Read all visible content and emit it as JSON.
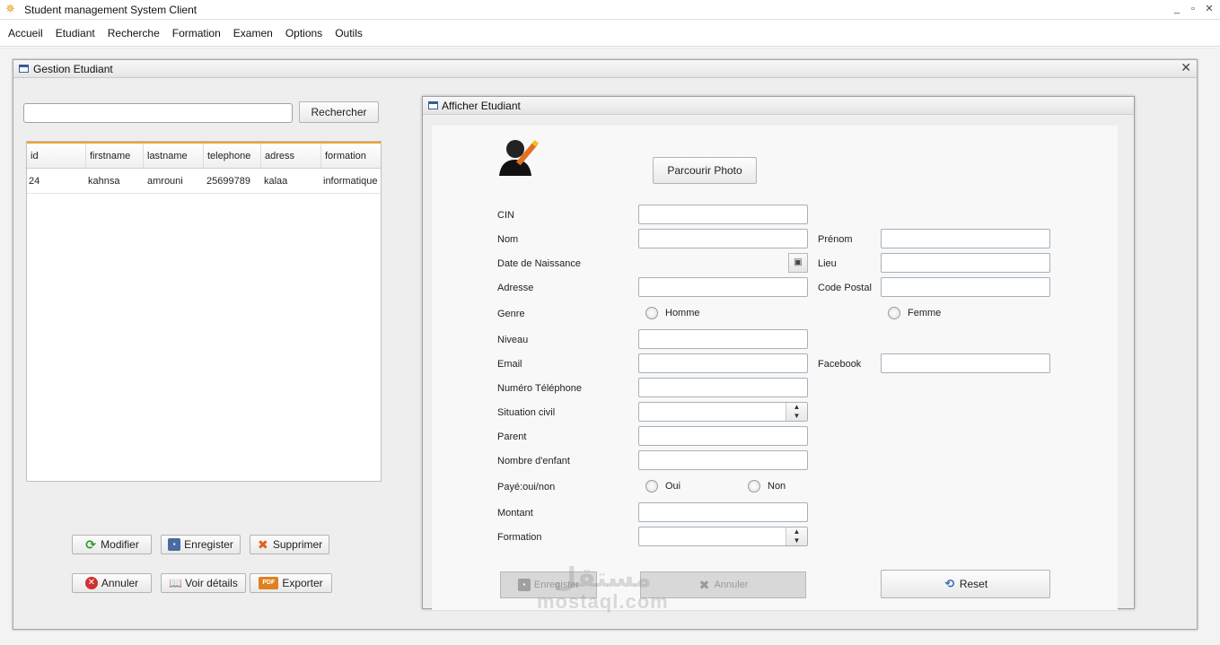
{
  "window": {
    "title": "Student management System Client",
    "controls": [
      "_",
      "▫",
      "✕"
    ]
  },
  "menu": [
    "Accueil",
    "Etudiant",
    "Recherche",
    "Formation",
    "Examen",
    "Options",
    "Outils"
  ],
  "gestion": {
    "title": "Gestion Etudiant",
    "search_button": "Rechercher",
    "search_value": "",
    "table": {
      "columns": [
        "id",
        "firstname",
        "lastname",
        "telephone",
        "adress",
        "formation"
      ],
      "rows": [
        [
          "24",
          "kahnsa",
          "amrouni",
          "25699789",
          "kalaa",
          "informatique"
        ]
      ]
    },
    "buttons": {
      "modifier": "Modifier",
      "enregister": "Enregister",
      "supprimer": "Supprimer",
      "annuler": "Annuler",
      "voir_details": "Voir détails",
      "exporter": "Exporter"
    }
  },
  "afficher": {
    "title": "Afficher Etudiant",
    "parcourir_photo": "Parcourir Photo",
    "labels": {
      "cin": "CIN",
      "nom": "Nom",
      "prenom": "Prénom",
      "date_naissance": "Date de Naissance",
      "lieu": "Lieu",
      "adresse": "Adresse",
      "code_postal": "Code Postal",
      "genre": "Genre",
      "homme": "Homme",
      "femme": "Femme",
      "niveau": "Niveau",
      "email": "Email",
      "facebook": "Facebook",
      "numero_telephone": "Numéro Téléphone",
      "situation_civil": "Situation civil",
      "parent": "Parent",
      "nombre_enfant": "Nombre d'enfant",
      "paye": "Payé:oui/non",
      "oui": "Oui",
      "non": "Non",
      "montant": "Montant",
      "formation": "Formation"
    },
    "buttons": {
      "enregister": "Enregister",
      "annuler": "Annuler",
      "reset": "Reset"
    }
  },
  "watermark": {
    "arabic": "مستقل",
    "latin": "mostaql.com"
  },
  "colors": {
    "table_header_accent": "#f0a030",
    "frame_icon": "#3a5a9a"
  }
}
